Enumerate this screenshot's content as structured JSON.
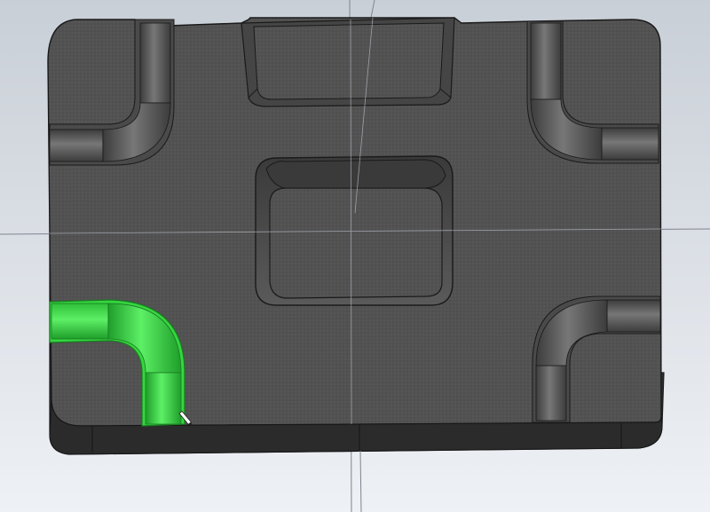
{
  "viewport": {
    "background_top": "#c9cfd7",
    "background_bottom": "#eef1f5"
  },
  "part": {
    "face_color": "#525252",
    "side_color": "#2f2f2f",
    "edge_color": "#1a1a1a",
    "selection_color": "#35d63f",
    "selection_shade": "#1f9e2a"
  },
  "icons": {
    "cursor": "pointer-cursor-icon"
  }
}
